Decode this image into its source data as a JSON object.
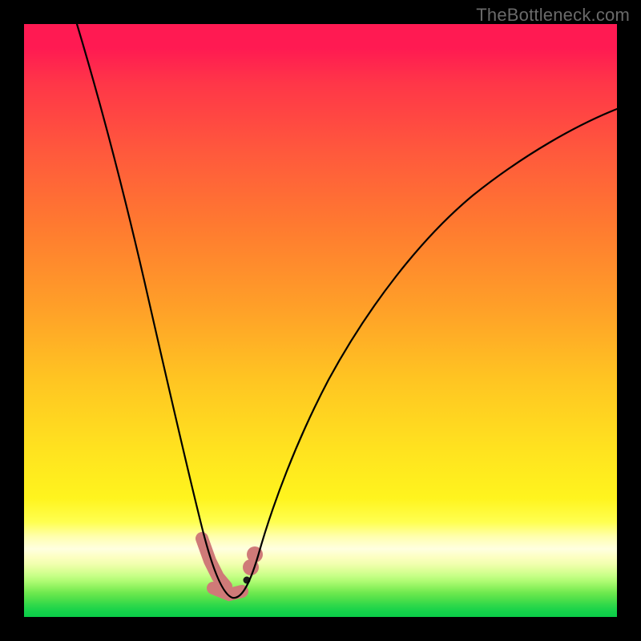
{
  "watermark": "TheBottleneck.com",
  "chart_data": {
    "type": "line",
    "title": "",
    "xlabel": "",
    "ylabel": "",
    "xlim": [
      0,
      100
    ],
    "ylim": [
      0,
      100
    ],
    "grid": false,
    "legend": false,
    "series": [
      {
        "name": "bottleneck-curve",
        "x": [
          9,
          12,
          15,
          18,
          21,
          24,
          26,
          28,
          29.5,
          31,
          32.5,
          34,
          35.5,
          38,
          42,
          48,
          55,
          63,
          72,
          82,
          92,
          100
        ],
        "y": [
          100,
          88,
          76,
          63,
          50,
          37,
          27,
          17,
          10,
          4,
          1,
          0.5,
          1.5,
          6,
          15,
          28,
          40,
          51,
          61,
          69,
          75,
          79
        ]
      }
    ],
    "highlight": {
      "name": "optimal-valley",
      "x": [
        29.5,
        31,
        32.5,
        34,
        35.5
      ],
      "y": [
        10,
        4,
        1,
        0.5,
        1.5
      ]
    },
    "background_bands": [
      {
        "color": "#ff1a52",
        "from_y": 100,
        "to_y": 80
      },
      {
        "color": "#ff7a30",
        "from_y": 80,
        "to_y": 50
      },
      {
        "color": "#ffe31f",
        "from_y": 50,
        "to_y": 15
      },
      {
        "color": "#ffffd0",
        "from_y": 15,
        "to_y": 9
      },
      {
        "color": "#6ce84e",
        "from_y": 9,
        "to_y": 3
      },
      {
        "color": "#0acc48",
        "from_y": 3,
        "to_y": 0
      }
    ]
  }
}
